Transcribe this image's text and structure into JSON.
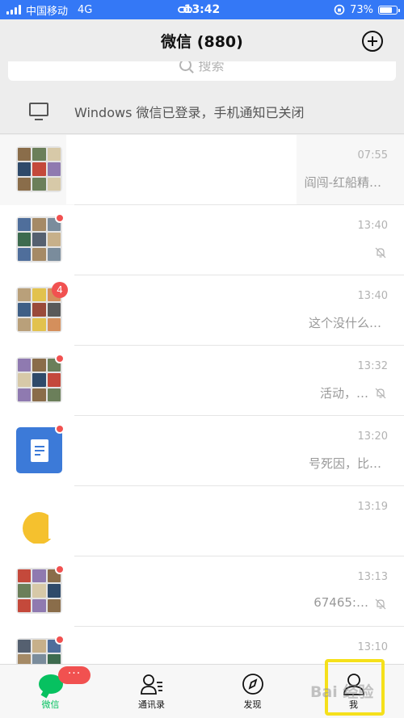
{
  "status_bar": {
    "carrier": "中国移动",
    "network": "4G",
    "time": "13:42",
    "battery_percent_text": "73%",
    "battery_level": 0.73
  },
  "header": {
    "title": "微信 (880)",
    "add_icon": "plus-circle-icon"
  },
  "search": {
    "placeholder": "搜索"
  },
  "banner": {
    "icon": "monitor-icon",
    "text": "Windows 微信已登录，手机通知已关闭"
  },
  "chats": [
    {
      "time": "07:55",
      "preview": "阎闯-红船精…",
      "badge": "",
      "dot": false,
      "muted": false,
      "pinned": true
    },
    {
      "time": "13:40",
      "preview": "",
      "badge": "",
      "dot": true,
      "muted": true,
      "pinned": false
    },
    {
      "time": "13:40",
      "preview": "这个没什么…",
      "badge": "4",
      "dot": false,
      "muted": false,
      "pinned": false
    },
    {
      "time": "13:32",
      "preview": "活动，…",
      "badge": "",
      "dot": true,
      "muted": true,
      "pinned": false
    },
    {
      "time": "13:20",
      "preview": "号死因，比…",
      "badge": "",
      "dot": true,
      "muted": false,
      "pinned": false
    },
    {
      "time": "13:19",
      "preview": "",
      "badge": "",
      "dot": false,
      "muted": false,
      "pinned": false
    },
    {
      "time": "13:13",
      "preview": "67465:…",
      "badge": "",
      "dot": true,
      "muted": true,
      "pinned": false
    },
    {
      "time": "13:10",
      "preview": "",
      "badge": "",
      "dot": true,
      "muted": false,
      "pinned": false
    }
  ],
  "tabs": [
    {
      "label": "微信",
      "icon": "chat-bubble-icon",
      "active": true,
      "badge": "···"
    },
    {
      "label": "通讯录",
      "icon": "contacts-icon",
      "active": false,
      "badge": ""
    },
    {
      "label": "发现",
      "icon": "compass-icon",
      "active": false,
      "badge": ""
    },
    {
      "label": "我",
      "icon": "person-icon",
      "active": false,
      "badge": ""
    }
  ],
  "watermark": "Bai 经验",
  "colors": {
    "status_bar": "#3478f6",
    "accent_green": "#07c160",
    "badge_red": "#f15150",
    "highlight": "#f5e01b"
  }
}
